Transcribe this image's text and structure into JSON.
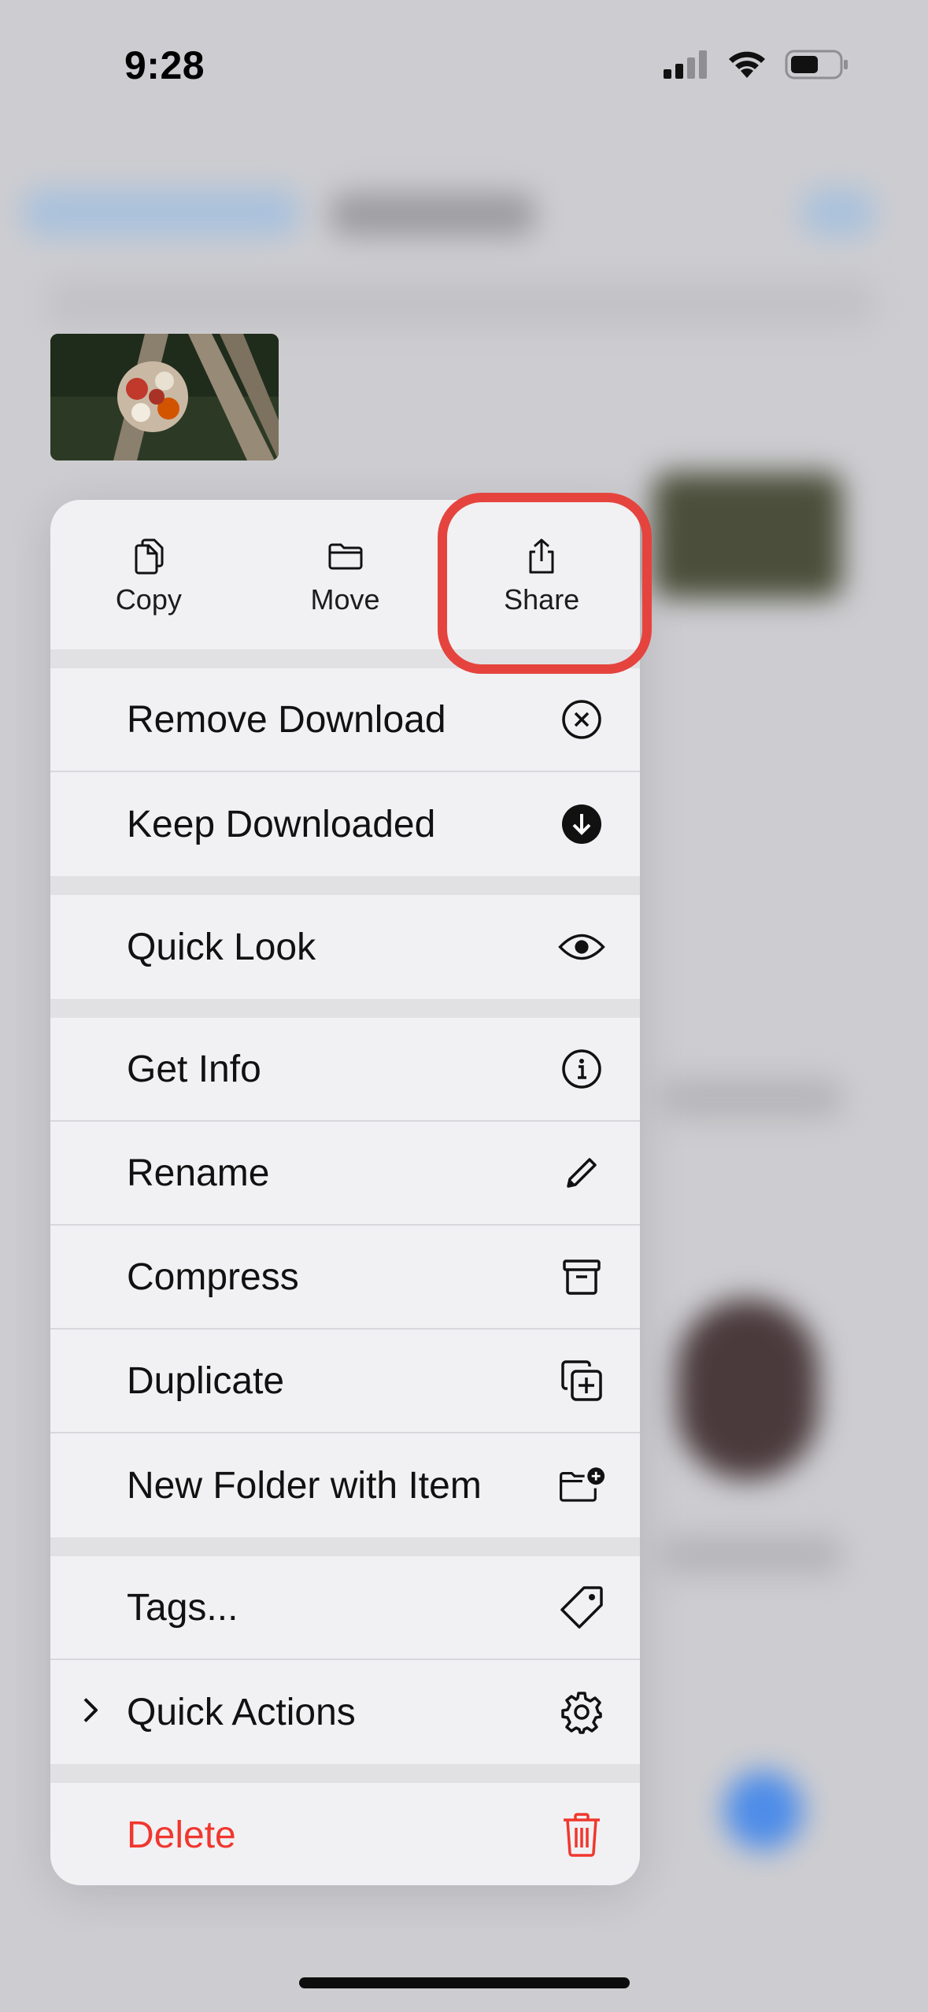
{
  "status_bar": {
    "time": "9:28"
  },
  "top_actions": [
    {
      "label": "Copy",
      "icon": "copy-icon"
    },
    {
      "label": "Move",
      "icon": "folder-icon"
    },
    {
      "label": "Share",
      "icon": "share-icon"
    }
  ],
  "menu_items": {
    "remove_download": "Remove Download",
    "keep_downloaded": "Keep Downloaded",
    "quick_look": "Quick Look",
    "get_info": "Get Info",
    "rename": "Rename",
    "compress": "Compress",
    "duplicate": "Duplicate",
    "new_folder_with_item": "New Folder with Item",
    "tags": "Tags...",
    "quick_actions": "Quick Actions",
    "delete": "Delete"
  },
  "colors": {
    "destructive": "#f0372e",
    "highlight": "#e5443e",
    "menu_background": "#f1f1f3"
  }
}
